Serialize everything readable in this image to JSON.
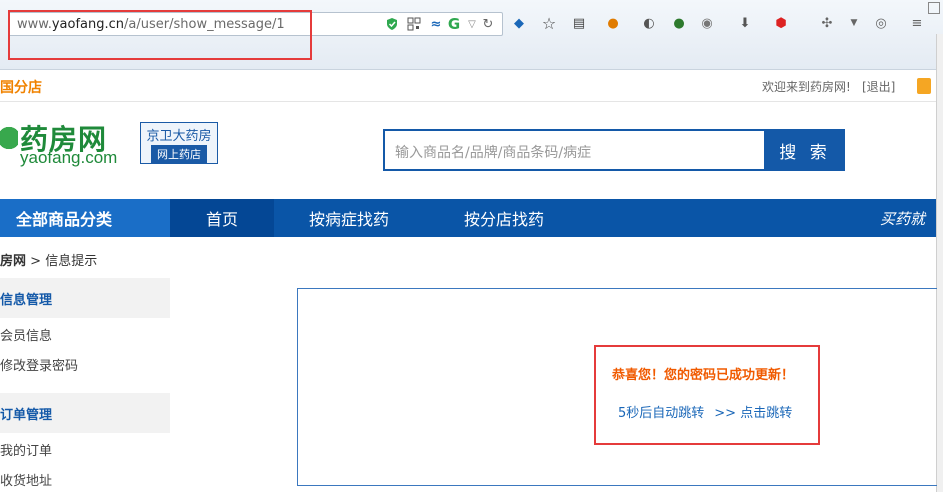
{
  "browser": {
    "url_prefix": "www.",
    "url_domain": "yaofang.cn",
    "url_path": "/a/user/show_message/1"
  },
  "topbar": {
    "region": "国分店",
    "welcome": "欢迎来到药房网!",
    "logout": "[退出]"
  },
  "header": {
    "logo_cn": "药房网",
    "logo_domain": "yaofang.com",
    "shop_name": "京卫大药房",
    "shop_sub": "网上药店",
    "search_placeholder": "输入商品名/品牌/商品条码/病症",
    "search_button": "搜 索"
  },
  "nav": {
    "all_categories": "全部商品分类",
    "items": [
      "首页",
      "按病症找药",
      "按分店找药"
    ],
    "slogan": "买药就"
  },
  "breadcrumb": {
    "home": "房网",
    "separator": ">",
    "current": "信息提示"
  },
  "sidebar": {
    "sections": [
      {
        "title": "信息管理",
        "items": [
          "会员信息",
          "修改登录密码"
        ]
      },
      {
        "title": "订单管理",
        "items": [
          "我的订单",
          "收货地址"
        ]
      }
    ]
  },
  "message": {
    "success": "恭喜您！您的密码已成功更新！",
    "auto_redirect": "5秒后自动跳转",
    "click_redirect": ">> 点击跳转"
  },
  "colors": {
    "nav_blue": "#0a55a7",
    "accent_orange": "#f08200",
    "highlight_red": "#e53b3b"
  }
}
